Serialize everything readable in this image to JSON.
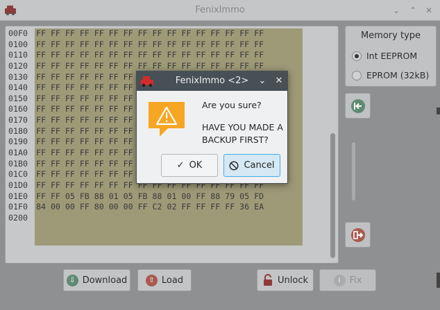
{
  "window": {
    "title": "FenixImmo",
    "controls": [
      "chevron-down",
      "chevron-up",
      "close"
    ]
  },
  "hex": {
    "rows": [
      {
        "addr": "00F0",
        "bytes": "FF FF FF FF FF FF FF FF FF FF FF FF FF FF FF FF"
      },
      {
        "addr": "0100",
        "bytes": "FF FF FF FF FF FF FF FF FF FF FF FF FF FF FF FF"
      },
      {
        "addr": "0110",
        "bytes": "FF FF FF FF FF FF FF FF FF FF FF FF FF FF FF FF"
      },
      {
        "addr": "0120",
        "bytes": "FF FF FF FF FF FF FF FF FF FF FF FF FF FF FF FF"
      },
      {
        "addr": "0130",
        "bytes": "FF FF FF FF FF FF FF FF FF FF FF FF FF FF FF FF"
      },
      {
        "addr": "0140",
        "bytes": "FF FF FF FF FF FF FF FF FF FF FF FF FF FF FF FF"
      },
      {
        "addr": "0150",
        "bytes": "FF FF FF FF FF FF FF FF FF FF FF FF FF FF FF FF"
      },
      {
        "addr": "0160",
        "bytes": "FF FF FF FF FF FF FF FF FF FF FF FF FF FF FF FF"
      },
      {
        "addr": "0170",
        "bytes": "FF FF FF FF FF FF FF FF FF FF FF FF FF FF FF FF"
      },
      {
        "addr": "0180",
        "bytes": "FF FF FF FF FF FF FF FF FF FF FF FF FF FF FF FF"
      },
      {
        "addr": "0190",
        "bytes": "FF FF FF FF FF FF FF FF FF FF FF FF FF FF FF FF"
      },
      {
        "addr": "01A0",
        "bytes": "FF FF FF FF FF FF FF FF FF FF FF FF FF FF FF FF"
      },
      {
        "addr": "01B0",
        "bytes": "FF FF FF FF FF FF FF FF FF FF FF FF FF FF FF FF"
      },
      {
        "addr": "01C0",
        "bytes": "FF FF FF FF FF FF FF FF FF FF FF FF FF FF FF FF"
      },
      {
        "addr": "01D0",
        "bytes": "FF FF FF FF FF FF FF FF FF FF FF FF FF FF FF FF"
      },
      {
        "addr": "01E0",
        "bytes": "FF FF 05 FB 88 01 05 FB 88 01 00 FF 88 79 05 FD"
      },
      {
        "addr": "01F0",
        "bytes": "84 00 00 FF 80 00 00 FF C2 02 FF FF FF FF 36 EA"
      },
      {
        "addr": "0200",
        "bytes": ""
      }
    ]
  },
  "memory_type": {
    "title": "Memory type",
    "options": [
      {
        "label": "Int EEPROM",
        "selected": true
      },
      {
        "label": "EPROM (32kB)",
        "selected": false
      }
    ]
  },
  "side_buttons": {
    "import_icon": "import-arrow-icon",
    "export_icon": "export-arrow-icon"
  },
  "bottom_buttons": {
    "download": "Download",
    "load": "Load",
    "unlock": "Unlock",
    "fix": "Fix"
  },
  "dialog": {
    "title": "FenixImmo <2>",
    "question": "Are you sure?",
    "message": "HAVE YOU MADE A BACKUP FIRST?",
    "ok_label": "OK",
    "cancel_label": "Cancel",
    "icon": "warning-icon"
  },
  "colors": {
    "accent": "#3daee9",
    "hex_highlight": "#9e9a78",
    "dialog_title_bg": "#475057",
    "app_icon": "#d42b2b"
  }
}
